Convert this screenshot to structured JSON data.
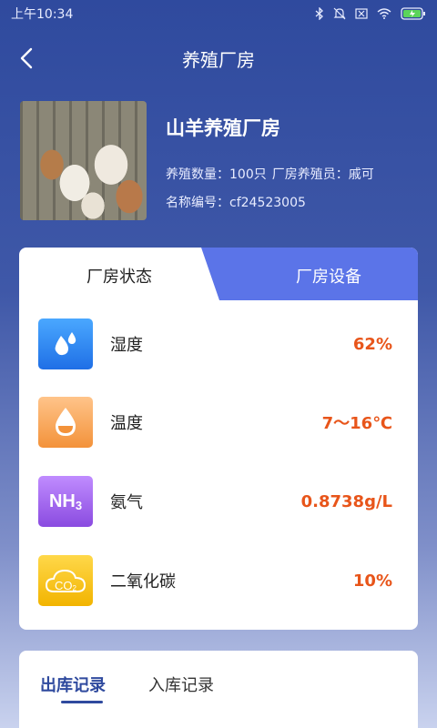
{
  "status_bar": {
    "time": "上午10:34"
  },
  "nav": {
    "title": "养殖厂房"
  },
  "farm": {
    "name": "山羊养殖厂房",
    "count_label": "养殖数量：100只",
    "keeper_label": "厂房养殖员：戚可",
    "code_label": "名称编号：cf24523005"
  },
  "tabs": {
    "status": "厂房状态",
    "equipment": "厂房设备"
  },
  "metrics": [
    {
      "label": "湿度",
      "value": "62%",
      "icon": "humidity-icon"
    },
    {
      "label": "温度",
      "value": "7～16℃",
      "icon": "temperature-icon"
    },
    {
      "label": "氨气",
      "value": "0.8738g/L",
      "icon": "nh3-icon"
    },
    {
      "label": "二氧化碳",
      "value": "10%",
      "icon": "co2-icon"
    }
  ],
  "icon_text": {
    "nh3": "NH",
    "nh3_sub": "3",
    "co2": "CO",
    "co2_sub": "2"
  },
  "records": {
    "out_tab": "出库记录",
    "in_tab": "入库记录"
  },
  "colors": {
    "accent": "#2f4a9e",
    "tab_active_bg": "#5b74e8",
    "value": "#e8551a"
  }
}
